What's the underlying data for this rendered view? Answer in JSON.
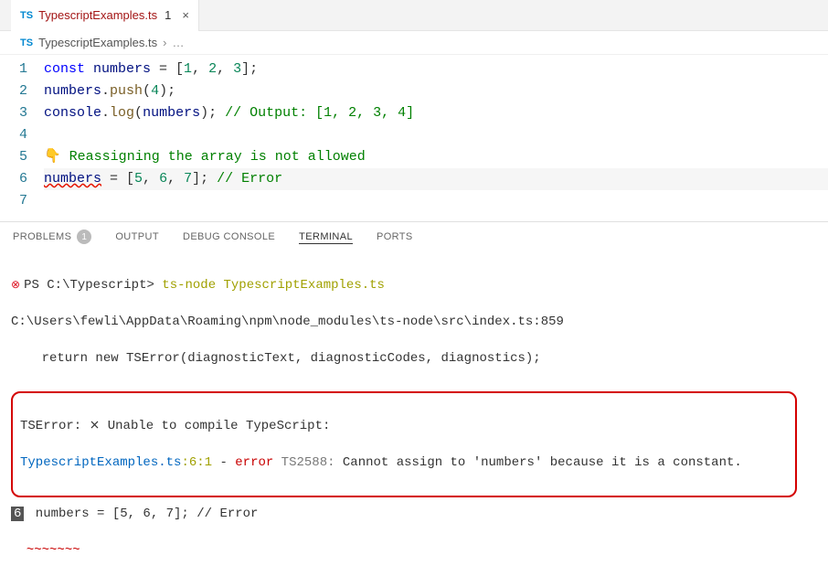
{
  "tab": {
    "icon_label": "TS",
    "title": "TypescriptExamples.ts",
    "dirty_indicator": "1",
    "close_glyph": "×"
  },
  "breadcrumb": {
    "icon_label": "TS",
    "file": "TypescriptExamples.ts",
    "chevron": "›",
    "dots": "…"
  },
  "editor": {
    "line_numbers": [
      "1",
      "2",
      "3",
      "4",
      "5",
      "6",
      "7"
    ],
    "lines": {
      "l1_kw": "const",
      "l1_var": " numbers",
      "l1_rest1": " = [",
      "l1_n1": "1",
      "l1_c1": ", ",
      "l1_n2": "2",
      "l1_c2": ", ",
      "l1_n3": "3",
      "l1_rest2": "];",
      "l2_var": "numbers",
      "l2_dot": ".",
      "l2_fn": "push",
      "l2_rest": "(",
      "l2_num": "4",
      "l2_end": ");",
      "l3_obj": "console",
      "l3_dot": ".",
      "l3_fn": "log",
      "l3_open": "(",
      "l3_arg": "numbers",
      "l3_close": "); ",
      "l3_comment": "// Output: [1, 2, 3, 4]",
      "l5_comment": "👇 Reassigning the array is not allowed",
      "l6_var": "numbers",
      "l6_rest": " = [",
      "l6_n1": "5",
      "l6_c1": ", ",
      "l6_n2": "6",
      "l6_c2": ", ",
      "l6_n3": "7",
      "l6_end": "]; ",
      "l6_comment": "// Error"
    }
  },
  "panel": {
    "tabs": {
      "problems": "PROBLEMS",
      "problems_badge": "1",
      "output": "OUTPUT",
      "debug": "DEBUG CONSOLE",
      "terminal": "TERMINAL",
      "ports": "PORTS"
    }
  },
  "terminal": {
    "err_glyph": "⊗",
    "prompt": "PS C:\\Typescript> ",
    "command": "ts-node TypescriptExamples.ts",
    "path_line": "C:\\Users\\fewli\\AppData\\Roaming\\npm\\node_modules\\ts-node\\src\\index.ts:859",
    "return_line": "    return new TSError(diagnosticText, diagnosticCodes, diagnostics);",
    "err_header": "TSError: ⨯ Unable to compile TypeScript:",
    "err_file": "TypescriptExamples.ts",
    "err_loc": ":6:1",
    "err_dash": " - ",
    "err_word": "error",
    "err_code": " TS2588: ",
    "err_msg": "Cannot assign to 'numbers' because it is a constant.",
    "snippet_badge": "6",
    "snippet_code": " numbers = [5, 6, 7]; // Error",
    "wavy_spaces": "  ",
    "wavy_tildes": "~~~~~~~"
  }
}
